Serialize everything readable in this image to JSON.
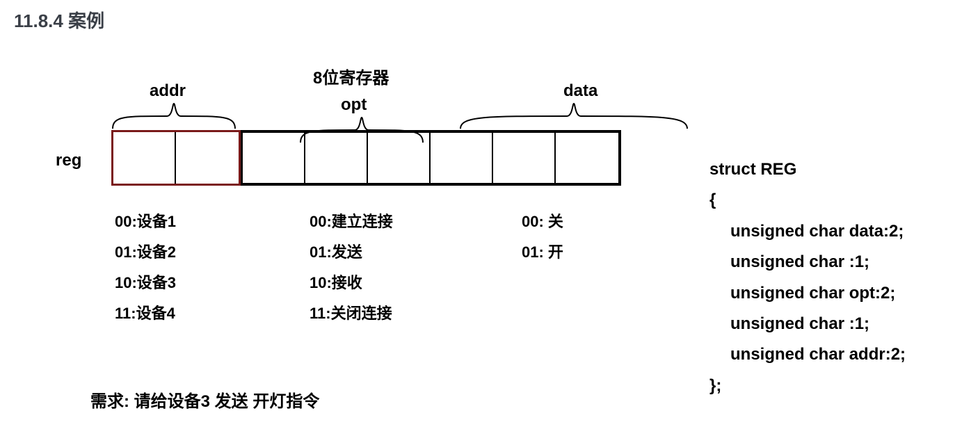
{
  "heading": "11.8.4 案例",
  "register_title": "8位寄存器",
  "fields": {
    "addr": {
      "label": "addr"
    },
    "opt": {
      "label": "opt"
    },
    "data": {
      "label": "data"
    }
  },
  "reg_label": "reg",
  "values": {
    "addr": [
      "00:设备1",
      "01:设备2",
      "10:设备3",
      "11:设备4"
    ],
    "opt": [
      "00:建立连接",
      "01:发送",
      "10:接收",
      "11:关闭连接"
    ],
    "data": [
      "00:  关",
      "01:  开"
    ]
  },
  "requirement": "需求:  请给设备3 发送 开灯指令",
  "code": {
    "l1": "struct REG",
    "l2": "{",
    "l3": "unsigned char data:2;",
    "l4": "unsigned char :1;",
    "l5": "unsigned char opt:2;",
    "l6": "unsigned char :1;",
    "l7": "unsigned char addr:2;",
    "l8": "};"
  }
}
